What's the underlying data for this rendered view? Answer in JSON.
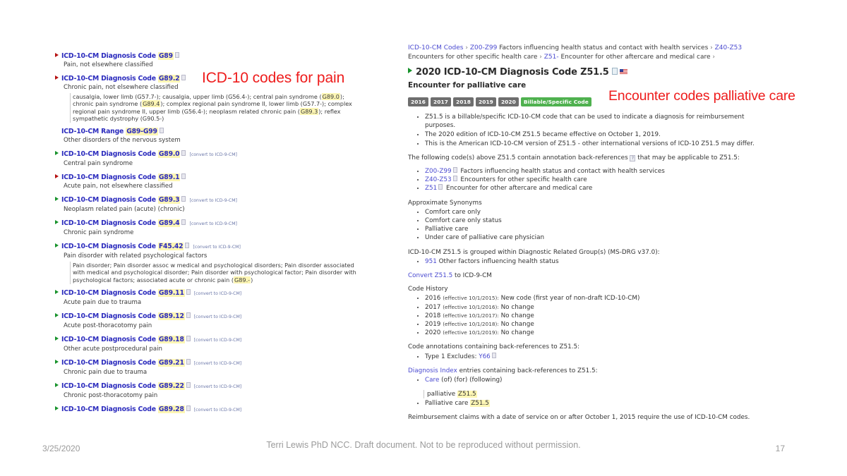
{
  "annotations": {
    "left": "ICD-10 codes for pain",
    "right": "Encounter codes palliative care",
    "color": "#ee1c1c"
  },
  "left_panel": {
    "entries": [
      {
        "label": "ICD-10-CM Diagnosis Code",
        "code": "G89",
        "triangle": "red",
        "convert": "",
        "desc": "Pain, not elsewhere classified",
        "sub": ""
      },
      {
        "label": "ICD-10-CM Diagnosis Code",
        "code": "G89.2",
        "triangle": "red",
        "convert": "",
        "desc": "Chronic pain, not elsewhere classified",
        "sub": "causalgia, lower limb (G57.7-); causalgia, upper limb (G56.4-); central pain syndrome (G89.0); chronic pain syndrome (G89.4); complex regional pain syndrome II, lower limb (G57.7-); complex regional pain syndrome II, upper limb (G56.4-); neoplasm related chronic pain (G89.3); reflex sympathetic dystrophy (G90.5-)"
      },
      {
        "label": "ICD-10-CM Range",
        "code": "G89-G99",
        "triangle": "none",
        "convert": "",
        "desc": "Other disorders of the nervous system",
        "sub": ""
      },
      {
        "label": "ICD-10-CM Diagnosis Code",
        "code": "G89.0",
        "triangle": "green",
        "convert": "[convert to ICD-9-CM]",
        "desc": "Central pain syndrome",
        "sub": ""
      },
      {
        "label": "ICD-10-CM Diagnosis Code",
        "code": "G89.1",
        "triangle": "red",
        "convert": "",
        "desc": "Acute pain, not elsewhere classified",
        "sub": ""
      },
      {
        "label": "ICD-10-CM Diagnosis Code",
        "code": "G89.3",
        "triangle": "green",
        "convert": "[convert to ICD-9-CM]",
        "desc": "Neoplasm related pain (acute) (chronic)",
        "sub": ""
      },
      {
        "label": "ICD-10-CM Diagnosis Code",
        "code": "G89.4",
        "triangle": "green",
        "convert": "[convert to ICD-9-CM]",
        "desc": "Chronic pain syndrome",
        "sub": ""
      },
      {
        "label": "ICD-10-CM Diagnosis Code",
        "code": "F45.42",
        "triangle": "green",
        "convert": "[convert to ICD-9-CM]",
        "desc": "Pain disorder with related psychological factors",
        "sub": "Pain disorder; Pain disorder assoc w medical and psychological disorders; Pain disorder associated with medical and psychological disorder; Pain disorder with psychological factor; Pain disorder with psychological factors; associated acute or chronic pain (G89.-)"
      },
      {
        "label": "ICD-10-CM Diagnosis Code",
        "code": "G89.11",
        "triangle": "green",
        "convert": "[convert to ICD-9-CM]",
        "desc": "Acute pain due to trauma",
        "sub": ""
      },
      {
        "label": "ICD-10-CM Diagnosis Code",
        "code": "G89.12",
        "triangle": "green",
        "convert": "[convert to ICD-9-CM]",
        "desc": "Acute post-thoracotomy pain",
        "sub": ""
      },
      {
        "label": "ICD-10-CM Diagnosis Code",
        "code": "G89.18",
        "triangle": "green",
        "convert": "[convert to ICD-9-CM]",
        "desc": "Other acute postprocedural pain",
        "sub": ""
      },
      {
        "label": "ICD-10-CM Diagnosis Code",
        "code": "G89.21",
        "triangle": "green",
        "convert": "[convert to ICD-9-CM]",
        "desc": "Chronic pain due to trauma",
        "sub": ""
      },
      {
        "label": "ICD-10-CM Diagnosis Code",
        "code": "G89.22",
        "triangle": "green",
        "convert": "[convert to ICD-9-CM]",
        "desc": "Chronic post-thoracotomy pain",
        "sub": ""
      },
      {
        "label": "ICD-10-CM Diagnosis Code",
        "code": "G89.28",
        "triangle": "green",
        "convert": "[convert to ICD-9-CM]",
        "desc": "",
        "sub": ""
      }
    ]
  },
  "right_panel": {
    "breadcrumb": {
      "root": "ICD-10-CM Codes",
      "sep": "›",
      "c1_code": "Z00-Z99",
      "c1_text": "Factors influencing health status and contact with health services",
      "c2_code": "Z40-Z53",
      "c2_text": "Encounters for other specific health care",
      "c3_code": "Z51-",
      "c3_text": "Encounter for other aftercare and medical care"
    },
    "title": "2020 ICD-10-CM Diagnosis Code Z51.5",
    "subtitle": "Encounter for palliative care",
    "badges": [
      "2016",
      "2017",
      "2018",
      "2019",
      "2020"
    ],
    "billable_badge": "Billable/Specific Code",
    "billable_color": "#4fb14f",
    "facts": [
      "Z51.5 is a billable/specific ICD-10-CM code that can be used to indicate a diagnosis for reimbursement purposes.",
      "The 2020 edition of ICD-10-CM Z51.5 became effective on October 1, 2019.",
      "This is the American ICD-10-CM version of Z51.5 - other international versions of ICD-10 Z51.5 may differ."
    ],
    "backref_intro_a": "The following code(s) above Z51.5 contain annotation back-references",
    "backref_intro_b": "that may be applicable to Z51.5:",
    "backref_items": [
      {
        "code": "Z00-Z99",
        "text": "Factors influencing health status and contact with health services"
      },
      {
        "code": "Z40-Z53",
        "text": "Encounters for other specific health care"
      },
      {
        "code": "Z51",
        "text": "Encounter for other aftercare and medical care"
      }
    ],
    "synonyms_heading": "Approximate Synonyms",
    "synonyms": [
      "Comfort care only",
      "Comfort care only status",
      "Palliative care",
      "Under care of palliative care physician"
    ],
    "drg_heading": "ICD-10-CM Z51.5 is grouped within Diagnostic Related Group(s) (MS-DRG v37.0):",
    "drg_code": "951",
    "drg_text": "Other factors influencing health status",
    "convert_a": "Convert",
    "convert_code": "Z51.5",
    "convert_b": "to ICD-9-CM",
    "history_heading": "Code History",
    "history": [
      {
        "year": "2016",
        "eff": "(effective 10/1/2015):",
        "note": "New code (first year of non-draft ICD-10-CM)"
      },
      {
        "year": "2017",
        "eff": "(effective 10/1/2016):",
        "note": "No change"
      },
      {
        "year": "2018",
        "eff": "(effective 10/1/2017):",
        "note": "No change"
      },
      {
        "year": "2019",
        "eff": "(effective 10/1/2018):",
        "note": "No change"
      },
      {
        "year": "2020",
        "eff": "(effective 10/1/2019):",
        "note": "No change"
      }
    ],
    "annot_heading": "Code annotations containing back-references to Z51.5:",
    "annot_item_label": "Type 1 Excludes:",
    "annot_item_code": "Y66",
    "index_heading_link": "Diagnosis Index",
    "index_heading_rest": "entries containing back-references to Z51.5:",
    "index_item1_link": "Care",
    "index_item1_rest": "(of) (for) (following)",
    "index_item1_sub_text": "palliative",
    "index_item1_sub_code": "Z51.5",
    "index_item2_text": "Palliative care",
    "index_item2_code": "Z51.5",
    "reimbursement": "Reimbursement claims with a date of service on or after October 1, 2015 require the use of ICD-10-CM codes."
  },
  "footer": {
    "date": "3/25/2020",
    "note": "Terri Lewis PhD NCC. Draft document. Not to be reproduced without permission.",
    "page": "17"
  }
}
